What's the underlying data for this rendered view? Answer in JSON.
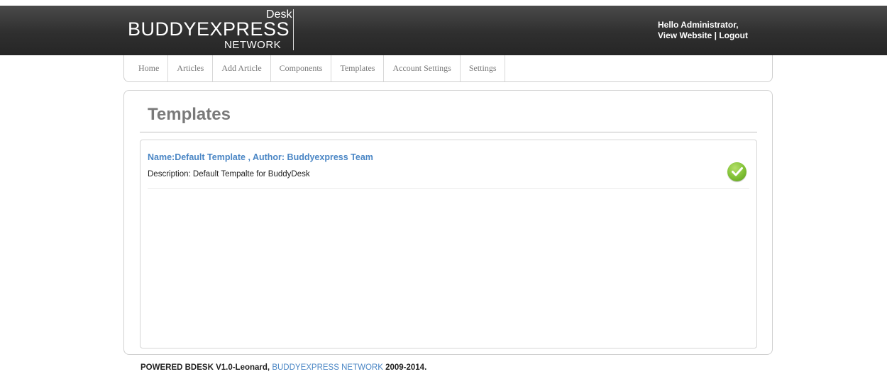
{
  "brand": {
    "desk": "Desk",
    "main": "BUDDYEXPRESS",
    "network": "NETWORK"
  },
  "user": {
    "greeting": "Hello Administrator,",
    "view_website": "View Website",
    "separator": "|",
    "logout": "Logout"
  },
  "nav": {
    "items": [
      {
        "label": "Home"
      },
      {
        "label": "Articles"
      },
      {
        "label": "Add Article"
      },
      {
        "label": "Components"
      },
      {
        "label": "Templates"
      },
      {
        "label": "Account Settings"
      },
      {
        "label": "Settings"
      }
    ]
  },
  "main": {
    "title": "Templates",
    "templates": [
      {
        "name": "Name:Default Template , Author: Buddyexpress Team",
        "description": "Description: Default Tempalte for BuddyDesk",
        "status_icon": "check-circle-icon",
        "status_color": "#7fc034"
      }
    ]
  },
  "footer": {
    "prefix": "POWERED BDESK V1.0-Leonard, ",
    "link": "BUDDYEXPRESS NETWORK",
    "suffix": " 2009-2014."
  },
  "colors": {
    "topbar": "#2f2f2f",
    "link": "#4a86c5",
    "title": "#7a7a7a"
  }
}
